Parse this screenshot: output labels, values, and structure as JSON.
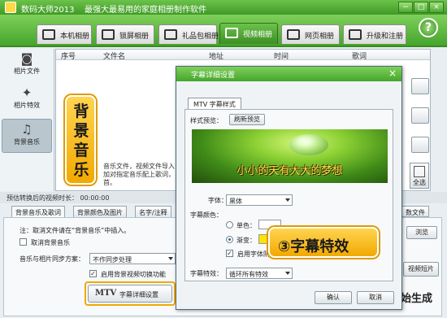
{
  "app": {
    "title": "数码大师2013",
    "subtitle": "最强大最易用的家庭相册制作软件",
    "window_buttons": [
      "−",
      "□",
      "×"
    ]
  },
  "main_tabs": [
    {
      "label": "本机相册"
    },
    {
      "label": "锁屏相册"
    },
    {
      "label": "礼品包相册"
    },
    {
      "label": "视频相册",
      "active": true
    },
    {
      "label": "网页相册"
    },
    {
      "label": "升级和注册"
    }
  ],
  "help_label": "?",
  "left_nav": [
    {
      "label": "相片文件",
      "icon": "camera-icon"
    },
    {
      "label": "相片特效",
      "icon": "effects-icon"
    },
    {
      "label": "背景音乐",
      "icon": "music-note-icon",
      "active": true
    }
  ],
  "table": {
    "columns": [
      "序号",
      "文件名",
      "地址",
      "时间",
      "歌词"
    ],
    "bg_lines": [
      "音乐文件，视频文件导入",
      "加对指定音乐配上歌词，",
      "首。"
    ]
  },
  "select_all_label": "全选",
  "duration_line": "预估转换后的视频时长： 00:00:00",
  "bottom_tabs": [
    {
      "label": "背景音乐及歌词",
      "active": true
    },
    {
      "label": "背景颜色及图片"
    },
    {
      "label": "名字/注释"
    }
  ],
  "import_file_label": "数文件",
  "bottom_panel": {
    "note": "注：取消文件请在“背景音乐”中插入。",
    "cancel_bg_music": "取消背景音乐",
    "sync_label": "音乐与相片同步方案：",
    "sync_value": "不作同步处理",
    "sync_switch": "启用背景视频切换功能",
    "browse": "浏览",
    "video_short": "视频短片",
    "mtv_mark": "MTV",
    "mtv_label": "字幕详细设置",
    "generate": "始生成"
  },
  "dialog": {
    "title": "字幕详细设置",
    "close": "×",
    "tab": "MTV 字幕样式",
    "preview_label": "样式预览：",
    "refresh_label": "刷新预览",
    "preview_text": "小小的天有大大的梦想",
    "font_label": "字体：",
    "font_value": "黑体",
    "color_label": "字幕颜色：",
    "single_color": "单色：",
    "gradient": "渐变：",
    "shadow_label": "启用字体阴影",
    "effect_label": "字幕特效：",
    "effect_value": "循环所有特效",
    "ok": "确认",
    "cancel": "取消"
  },
  "callouts": {
    "music": "背景音乐",
    "subtitle_effect": "③字幕特效"
  },
  "colors": {
    "green": "#45a52c",
    "callout": "#f2a900",
    "gradient_swatch": "#ffe400"
  }
}
